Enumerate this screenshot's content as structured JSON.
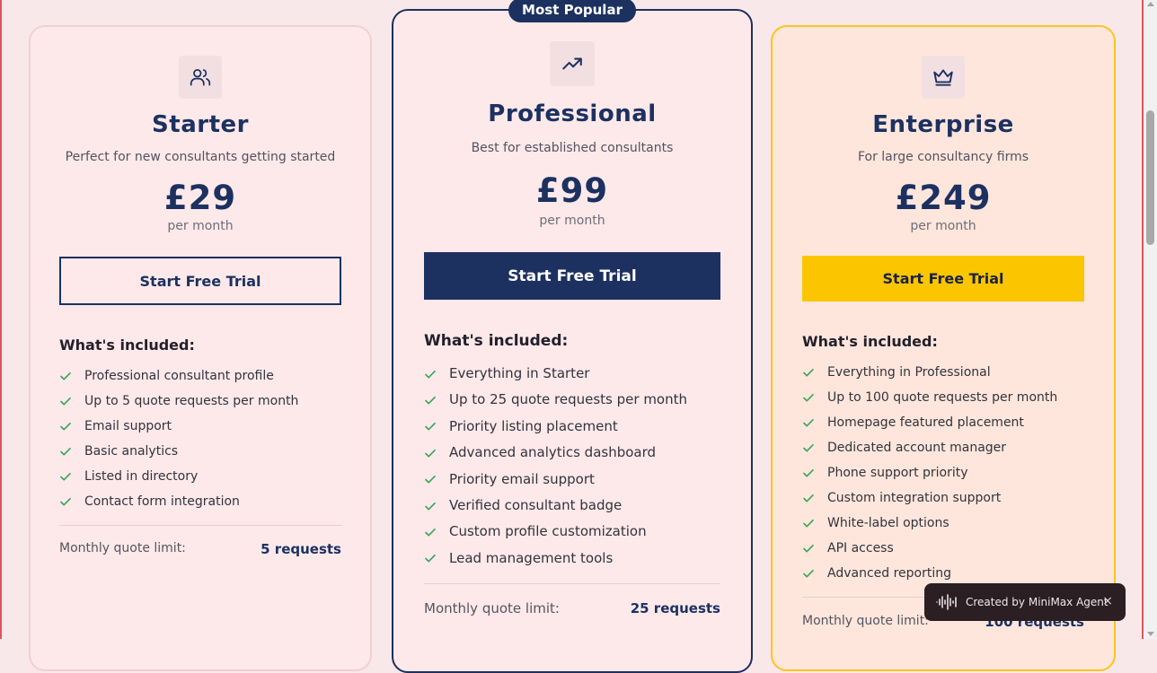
{
  "badge": "Most Popular",
  "included_heading": "What's included:",
  "limit_label": "Monthly quote limit:",
  "plans": [
    {
      "icon": "users-icon",
      "name": "Starter",
      "description": "Perfect for new consultants getting started",
      "price": "£29",
      "period": "per month",
      "cta": "Start Free Trial",
      "features": [
        "Professional consultant profile",
        "Up to 5 quote requests per month",
        "Email support",
        "Basic analytics",
        "Listed in directory",
        "Contact form integration"
      ],
      "limit": "5 requests"
    },
    {
      "icon": "trending-up-icon",
      "name": "Professional",
      "description": "Best for established consultants",
      "price": "£99",
      "period": "per month",
      "cta": "Start Free Trial",
      "features": [
        "Everything in Starter",
        "Up to 25 quote requests per month",
        "Priority listing placement",
        "Advanced analytics dashboard",
        "Priority email support",
        "Verified consultant badge",
        "Custom profile customization",
        "Lead management tools"
      ],
      "limit": "25 requests"
    },
    {
      "icon": "crown-icon",
      "name": "Enterprise",
      "description": "For large consultancy firms",
      "price": "£249",
      "period": "per month",
      "cta": "Start Free Trial",
      "features": [
        "Everything in Professional",
        "Up to 100 quote requests per month",
        "Homepage featured placement",
        "Dedicated account manager",
        "Phone support priority",
        "Custom integration support",
        "White-label options",
        "API access",
        "Advanced reporting"
      ],
      "limit": "100 requests"
    }
  ],
  "toast": {
    "text": "Created by MiniMax Agent",
    "close": "×"
  },
  "colors": {
    "navy": "#1d3161",
    "yellow": "#fbc600",
    "check": "#3aa65c",
    "background": "#f8e8ea"
  }
}
